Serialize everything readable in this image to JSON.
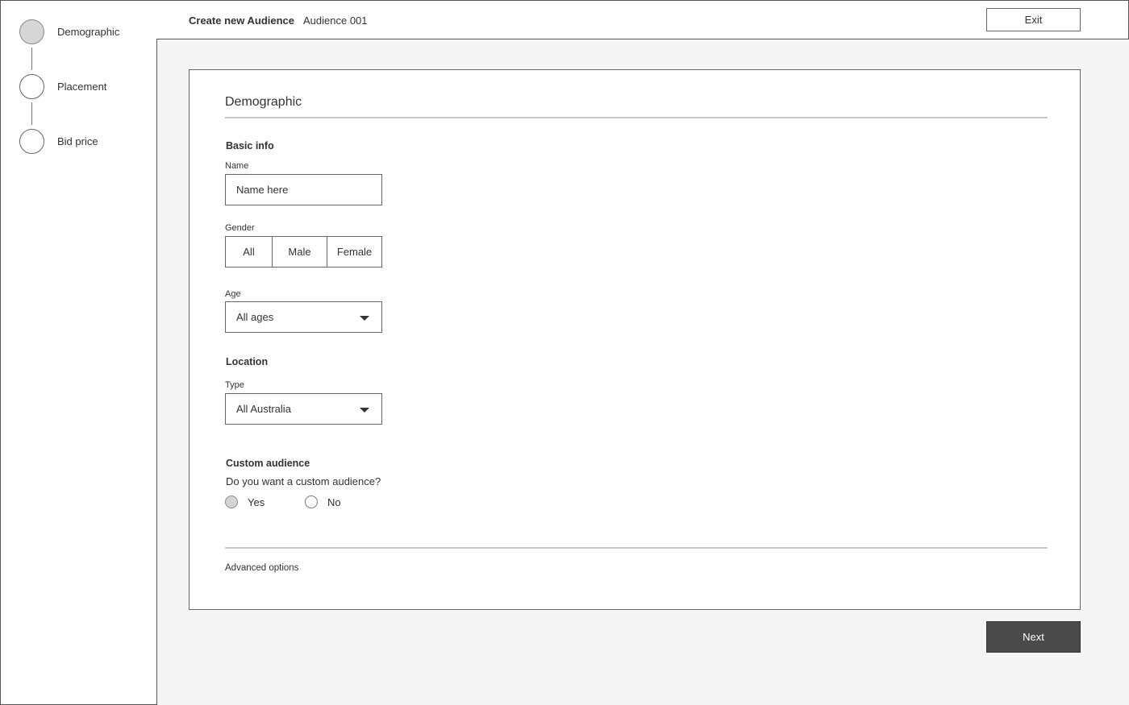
{
  "sidebar": {
    "steps": [
      {
        "label": "Demographic",
        "active": true
      },
      {
        "label": "Placement",
        "active": false
      },
      {
        "label": "Bid price",
        "active": false
      }
    ]
  },
  "header": {
    "title": "Create new Audience",
    "subtitle": "Audience 001",
    "exit_label": "Exit"
  },
  "form": {
    "title": "Demographic",
    "basic_info": {
      "heading": "Basic info",
      "name_label": "Name",
      "name_placeholder": "Name here",
      "gender_label": "Gender",
      "gender_options": [
        "All",
        "Male",
        "Female"
      ],
      "age_label": "Age",
      "age_value": "All ages"
    },
    "location": {
      "heading": "Location",
      "type_label": "Type",
      "type_value": "All Australia"
    },
    "custom_audience": {
      "heading": "Custom audience",
      "question": "Do you want a custom audience?",
      "options": [
        "Yes",
        "No"
      ],
      "selected": "Yes"
    },
    "advanced_label": "Advanced options"
  },
  "footer": {
    "next_label": "Next"
  },
  "colors": {
    "primary_button": "#4a4a4a",
    "active_step": "#d6d6d6",
    "background": "#f5f5f5"
  }
}
